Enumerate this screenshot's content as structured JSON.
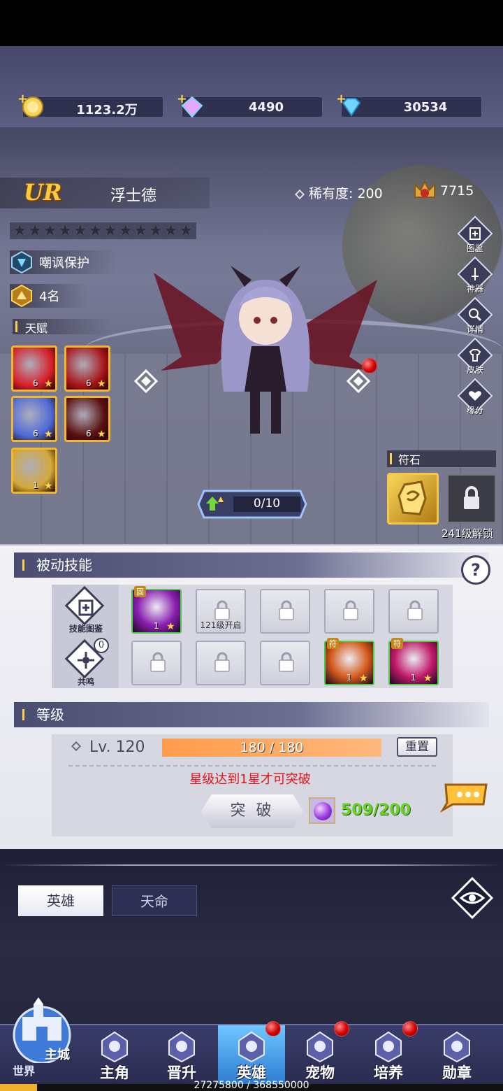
{
  "resources": [
    {
      "name": "gold",
      "value": "1123.2万"
    },
    {
      "name": "crystal",
      "value": "4490"
    },
    {
      "name": "diamond",
      "value": "30534"
    }
  ],
  "hero": {
    "rank": "UR",
    "name": "浮士德",
    "rarity_label": "稀有度:",
    "rarity_value": "200",
    "power": "7715",
    "stars_total": 12,
    "stars_filled": 0,
    "guard_tag": "嘲讽保护",
    "rank_tag": "4名",
    "talent_title": "天赋",
    "talents": [
      {
        "level": "6",
        "color": "#d8202a"
      },
      {
        "level": "6",
        "color": "#a8151a"
      },
      {
        "level": "6",
        "color": "#4f6ad8"
      },
      {
        "level": "6",
        "color": "#5a1010"
      },
      {
        "level": "1",
        "color": "#d4a93a"
      }
    ],
    "exp": "0/10"
  },
  "side_buttons": [
    "图鉴",
    "神器",
    "详情",
    "皮肤",
    "缘分"
  ],
  "rune": {
    "title": "符石",
    "unlock": "241级解锁"
  },
  "passive": {
    "title": "被动技能",
    "help": "?",
    "codex_label": "技能图鉴",
    "resonance_label": "共鸣",
    "resonance_count": "0",
    "slots": [
      {
        "state": "skill",
        "level": "1",
        "color": "#8a1fb0",
        "tag": "固"
      },
      {
        "state": "locked",
        "caption": "121级开启"
      },
      {
        "state": "locked",
        "caption": ""
      },
      {
        "state": "locked",
        "caption": ""
      },
      {
        "state": "locked",
        "caption": ""
      },
      {
        "state": "locked",
        "caption": ""
      },
      {
        "state": "locked",
        "caption": ""
      },
      {
        "state": "locked",
        "caption": ""
      },
      {
        "state": "skill",
        "level": "1",
        "color": "#d2581a",
        "tag": "符"
      },
      {
        "state": "skill",
        "level": "1",
        "color": "#c01a6a",
        "tag": "符"
      }
    ]
  },
  "level": {
    "title": "等级",
    "lv_label": "Lv. 120",
    "bar_text": "180 / 180",
    "bar_fraction": 1.0,
    "reset": "重置",
    "requirement": "星级达到1星才可突破",
    "breakthrough": "突 破",
    "cost": "509/200"
  },
  "tabs": {
    "active": "英雄",
    "idle": "天命"
  },
  "nav": {
    "home_top": "主城",
    "home_bottom": "世界",
    "items": [
      {
        "label": "主角",
        "dot": false
      },
      {
        "label": "晋升",
        "dot": false
      },
      {
        "label": "英雄",
        "dot": true
      },
      {
        "label": "宠物",
        "dot": true
      },
      {
        "label": "培养",
        "dot": true
      },
      {
        "label": "勋章",
        "dot": false
      }
    ]
  },
  "xp": {
    "text": "27275800 / 368550000",
    "fraction": 0.074
  }
}
